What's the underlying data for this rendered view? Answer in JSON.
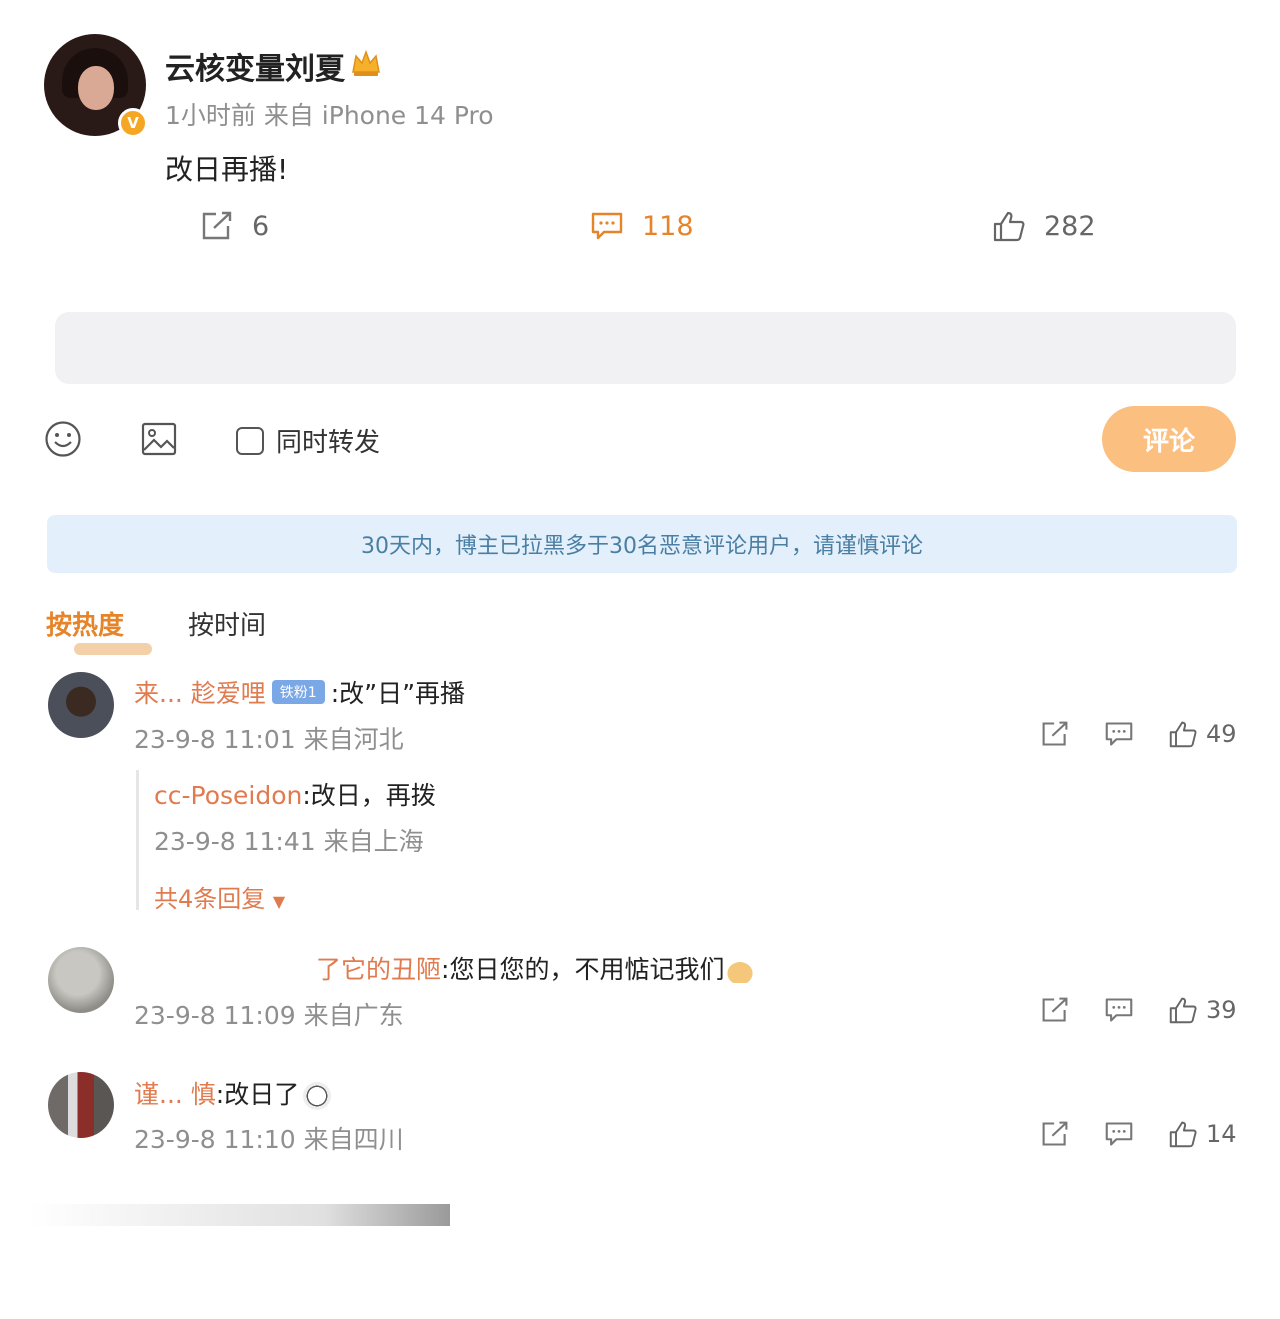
{
  "post": {
    "username": "云核变量刘夏",
    "verified_mark": "V",
    "meta": "1小时前  来自 iPhone 14 Pro",
    "text": "改日再播!",
    "repost_count": "6",
    "comment_count": "118",
    "like_count": "282"
  },
  "composer": {
    "repost_option": "同时转发",
    "submit_label": "评论"
  },
  "notice": "30天内，博主已拉黑多于30名恶意评论用户，请谨慎评论",
  "sort": {
    "hot": "按热度",
    "time": "按时间"
  },
  "comments": [
    {
      "name": "来... 趁爱哩",
      "badge": "铁粉1",
      "text": ":改”日”再播",
      "time": "23-9-8 11:01 来自河北",
      "likes": "49",
      "reply": {
        "name": "cc-Poseidon",
        "text": ":改日，再拨",
        "time": "23-9-8 11:41 来自上海",
        "more": "共4条回复"
      }
    },
    {
      "name": "了它的丑陋",
      "text": ":您日您的，不用惦记我们",
      "time": "23-9-8 11:09 来自广东",
      "likes": "39"
    },
    {
      "name": "谨... 慎",
      "text": ":改日了",
      "time": "23-9-8 11:10 来自四川",
      "likes": "14"
    }
  ],
  "colors": {
    "accent": "#e6842a",
    "name": "#e07b4f",
    "notice_bg": "#e3f0fb",
    "submit_bg": "#fbbf80"
  }
}
